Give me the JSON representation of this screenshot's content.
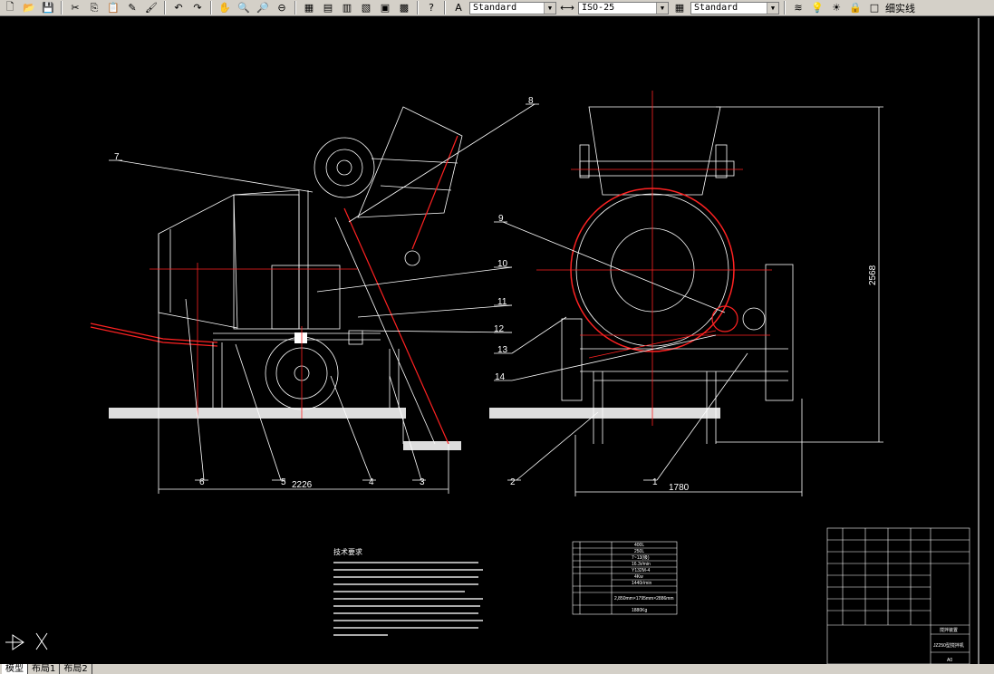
{
  "toolbar": {
    "text_style": "Standard",
    "dim_style": "ISO-25",
    "table_style": "Standard",
    "layer_text": "细实线"
  },
  "drawing": {
    "balloons": [
      "1",
      "2",
      "3",
      "4",
      "5",
      "6",
      "7",
      "8",
      "9",
      "10",
      "11",
      "12",
      "13",
      "14"
    ],
    "dims": {
      "left_width": "2226",
      "right_width": "1780",
      "height": "2568"
    },
    "notes_title": "技术要求",
    "spec_values": [
      "400L",
      "250L",
      "7~13(级)",
      "16.3r/min",
      "Y132M-4",
      "4Kw",
      "1440r/min",
      "2,850mm×1795mm×2886mm",
      "1880Kg"
    ],
    "title_block": {
      "name": "搅拌装置",
      "model": "JZ250型搅拌机",
      "sheet": "A0"
    }
  },
  "tabs": [
    "模型",
    "布局1",
    "布局2"
  ]
}
